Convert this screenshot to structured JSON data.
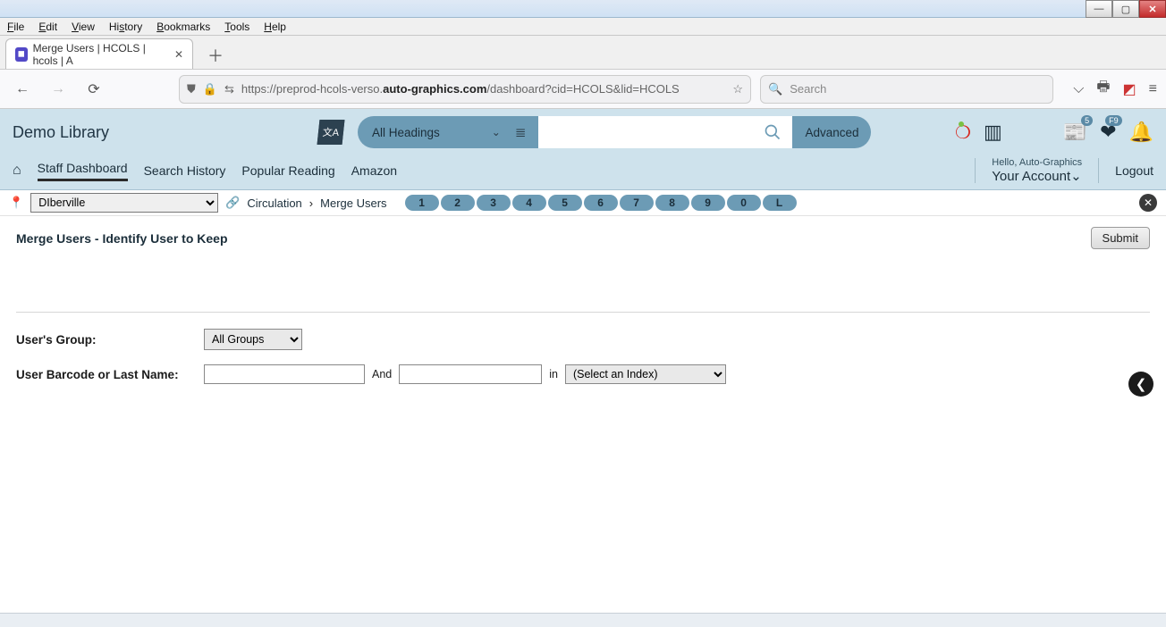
{
  "os_menubar": {
    "file": "File",
    "edit": "Edit",
    "view": "View",
    "history": "History",
    "bookmarks": "Bookmarks",
    "tools": "Tools",
    "help": "Help"
  },
  "browser": {
    "tab_title": "Merge Users | HCOLS | hcols | A",
    "url_prefix": "https://preprod-hcols-verso.",
    "url_host_bold": "auto-graphics.com",
    "url_suffix": "/dashboard?cid=HCOLS&lid=HCOLS",
    "search_placeholder": "Search"
  },
  "header": {
    "library_name": "Demo Library",
    "headings_label": "All Headings",
    "advanced_label": "Advanced",
    "badge_news": "5",
    "badge_heart": "F9"
  },
  "nav": {
    "items": [
      "Staff Dashboard",
      "Search History",
      "Popular Reading",
      "Amazon"
    ],
    "hello": "Hello, Auto-Graphics",
    "your_account": "Your Account",
    "logout": "Logout"
  },
  "subbar": {
    "location_selected": "DIberville",
    "breadcrumb_root": "Circulation",
    "breadcrumb_leaf": "Merge Users",
    "chips": [
      "1",
      "2",
      "3",
      "4",
      "5",
      "6",
      "7",
      "8",
      "9",
      "0",
      "L"
    ]
  },
  "page": {
    "title": "Merge Users - Identify User to Keep",
    "submit": "Submit",
    "group_label": "User's Group:",
    "group_value": "All Groups",
    "barcode_label": "User Barcode or Last Name:",
    "and": "And",
    "in": "in",
    "index_placeholder": "(Select an Index)"
  }
}
